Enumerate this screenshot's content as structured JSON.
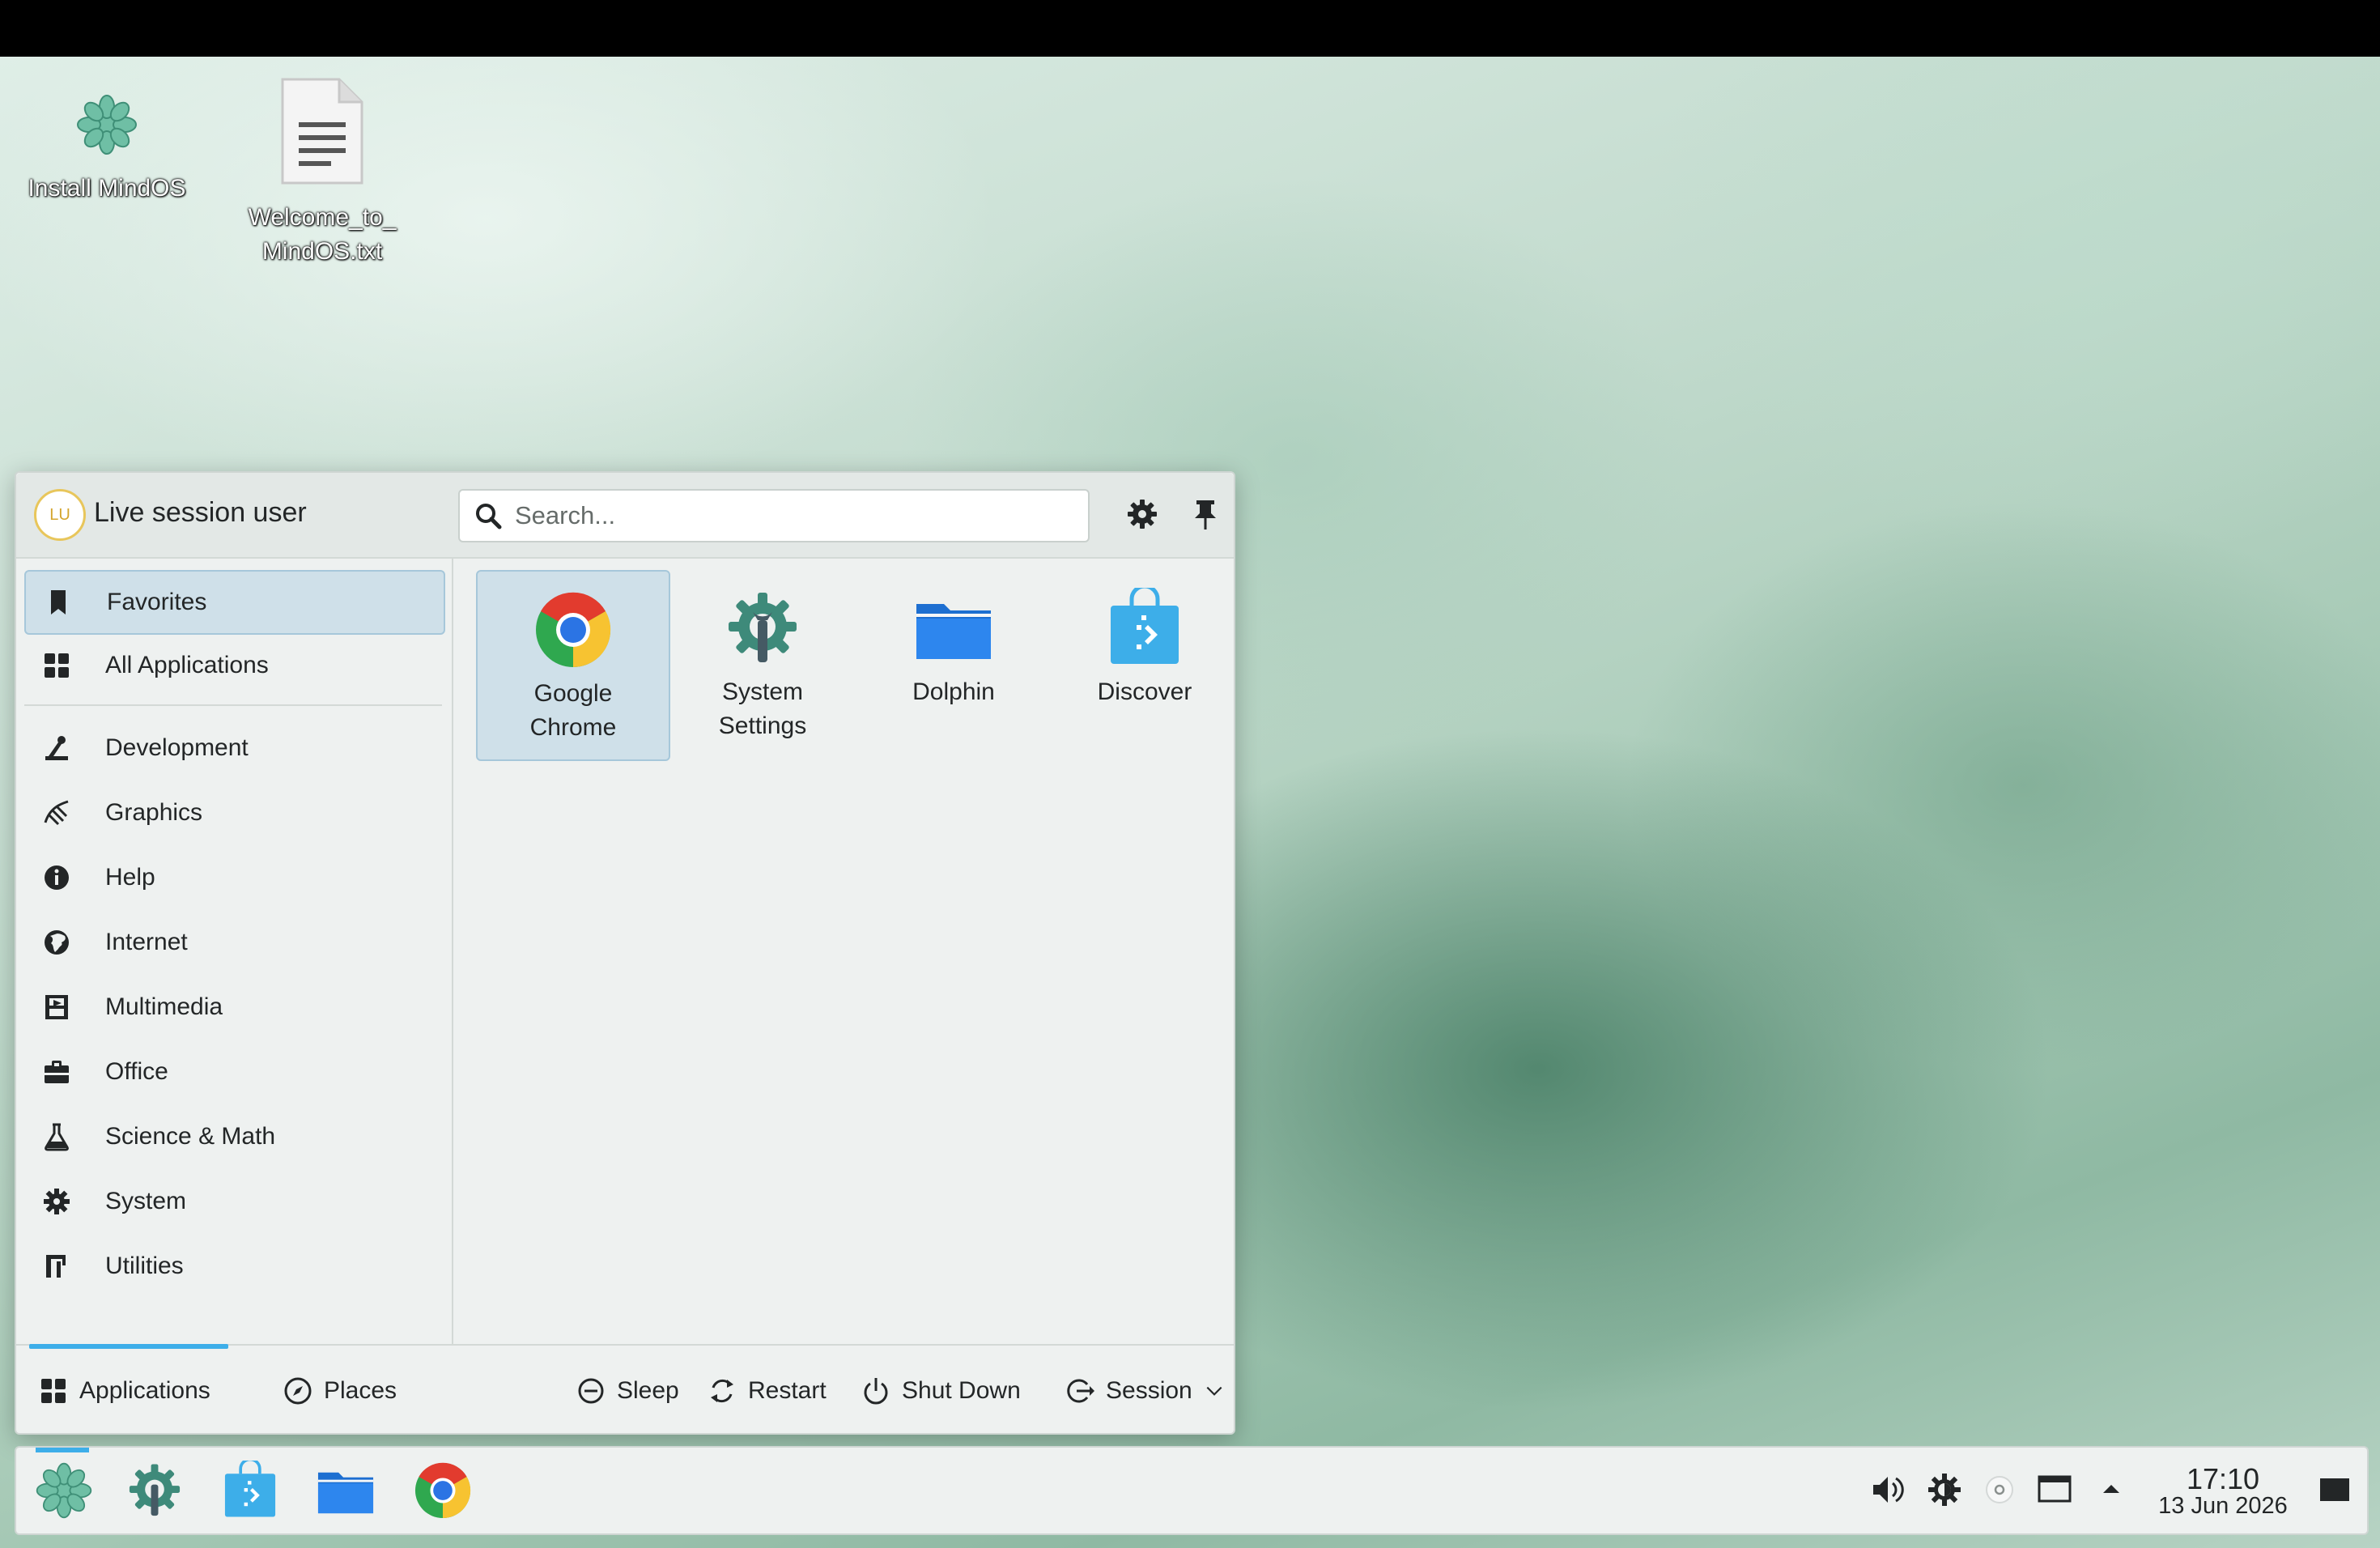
{
  "desktop": {
    "icons": [
      {
        "label": "Install MindOS",
        "icon": "mindos-logo-icon"
      },
      {
        "label_line1": "Welcome_to_",
        "label_line2": "MindOS.txt",
        "icon": "text-file-icon"
      }
    ]
  },
  "launcher": {
    "user": {
      "initials": "LU",
      "name": "Live session user"
    },
    "search": {
      "placeholder": "Search...",
      "value": ""
    },
    "header_buttons": [
      "configure-icon",
      "pin-icon"
    ],
    "categories": [
      {
        "label": "Favorites",
        "icon": "bookmark-icon",
        "selected": true
      },
      {
        "label": "All Applications",
        "icon": "grid-icon"
      },
      {
        "label": "Development",
        "icon": "development-icon"
      },
      {
        "label": "Graphics",
        "icon": "graphics-icon"
      },
      {
        "label": "Help",
        "icon": "info-icon"
      },
      {
        "label": "Internet",
        "icon": "globe-icon"
      },
      {
        "label": "Multimedia",
        "icon": "film-icon"
      },
      {
        "label": "Office",
        "icon": "briefcase-icon"
      },
      {
        "label": "Science & Math",
        "icon": "flask-icon"
      },
      {
        "label": "System",
        "icon": "gear-icon"
      },
      {
        "label": "Utilities",
        "icon": "utilities-icon"
      }
    ],
    "favorites": [
      {
        "line1": "Google",
        "line2": "Chrome",
        "icon": "chrome-icon",
        "selected": true
      },
      {
        "line1": "System",
        "line2": "Settings",
        "icon": "system-settings-icon"
      },
      {
        "line1": "Dolphin",
        "line2": "",
        "icon": "folder-icon"
      },
      {
        "line1": "Discover",
        "line2": "",
        "icon": "discover-icon"
      }
    ],
    "footer": {
      "tabs": [
        {
          "label": "Applications",
          "icon": "grid-icon",
          "active": true
        },
        {
          "label": "Places",
          "icon": "compass-icon"
        }
      ],
      "actions": [
        {
          "label": "Sleep",
          "icon": "sleep-icon"
        },
        {
          "label": "Restart",
          "icon": "restart-icon"
        },
        {
          "label": "Shut Down",
          "icon": "power-icon"
        },
        {
          "label": "Session",
          "icon": "session-icon"
        }
      ]
    }
  },
  "taskbar": {
    "tasks": [
      "mindos-logo-icon",
      "system-settings-icon",
      "discover-icon",
      "folder-icon",
      "chrome-icon"
    ],
    "tray": [
      "volume-icon",
      "brightness-icon",
      "network-icon",
      "display-icon",
      "expand-arrow-icon"
    ],
    "clock": {
      "time": "17:10",
      "date": "13 Jun 2026"
    },
    "desktop_button": "show-desktop-icon"
  },
  "colors": {
    "accent": "#3daee9",
    "selection_bg": "#cfe0e9",
    "panel_bg": "#eef1f0"
  }
}
